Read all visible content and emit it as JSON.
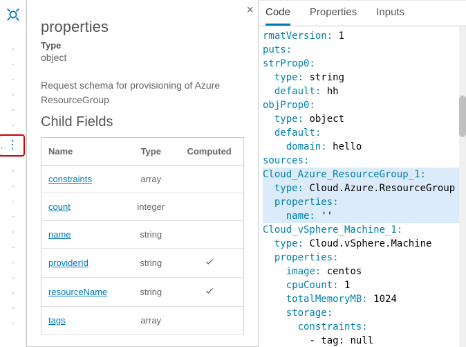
{
  "panel": {
    "heading": "properties",
    "type_label": "Type",
    "type_value": "object",
    "description": "Request schema for provisioning of Azure ResourceGroup",
    "child_heading": "Child Fields",
    "columns": {
      "name": "Name",
      "type": "Type",
      "computed": "Computed"
    },
    "fields": [
      {
        "name": "constraints",
        "type": "array",
        "computed": false
      },
      {
        "name": "count",
        "type": "integer",
        "computed": false
      },
      {
        "name": "name",
        "type": "string",
        "computed": false
      },
      {
        "name": "providerId",
        "type": "string",
        "computed": true
      },
      {
        "name": "resourceName",
        "type": "string",
        "computed": true
      },
      {
        "name": "tags",
        "type": "array",
        "computed": false
      }
    ]
  },
  "tabs": {
    "code": "Code",
    "properties": "Properties",
    "inputs": "Inputs"
  },
  "code": {
    "lines": [
      {
        "key": "rmatVersion",
        "val": "1"
      },
      {
        "key": "puts",
        "val": ""
      },
      {
        "key": "strProp0",
        "val": ""
      },
      {
        "indent": 1,
        "key": "type",
        "val": "string"
      },
      {
        "indent": 1,
        "key": "default",
        "val": "hh"
      },
      {
        "key": "objProp0",
        "val": ""
      },
      {
        "indent": 1,
        "key": "type",
        "val": "object"
      },
      {
        "indent": 1,
        "key": "default",
        "val": ""
      },
      {
        "indent": 2,
        "key": "domain",
        "val": "hello"
      },
      {
        "key": "sources",
        "val": ""
      },
      {
        "hl": true,
        "key": "Cloud_Azure_ResourceGroup_1",
        "val": ""
      },
      {
        "hl": true,
        "indent": 1,
        "key": "type",
        "val": "Cloud.Azure.ResourceGroup"
      },
      {
        "hl": true,
        "indent": 1,
        "key": "properties",
        "val": ""
      },
      {
        "hl": true,
        "indent": 2,
        "key": "name",
        "val": "''"
      },
      {
        "key": "Cloud_vSphere_Machine_1",
        "val": ""
      },
      {
        "indent": 1,
        "key": "type",
        "val": "Cloud.vSphere.Machine"
      },
      {
        "indent": 1,
        "key": "properties",
        "val": ""
      },
      {
        "indent": 2,
        "key": "image",
        "val": "centos"
      },
      {
        "indent": 2,
        "key": "cpuCount",
        "val": "1"
      },
      {
        "indent": 2,
        "key": "totalMemoryMB",
        "val": "1024"
      },
      {
        "indent": 2,
        "key": "storage",
        "val": ""
      },
      {
        "indent": 3,
        "key": "constraints",
        "val": ""
      },
      {
        "indent": 4,
        "raw": "- tag: null"
      }
    ]
  }
}
